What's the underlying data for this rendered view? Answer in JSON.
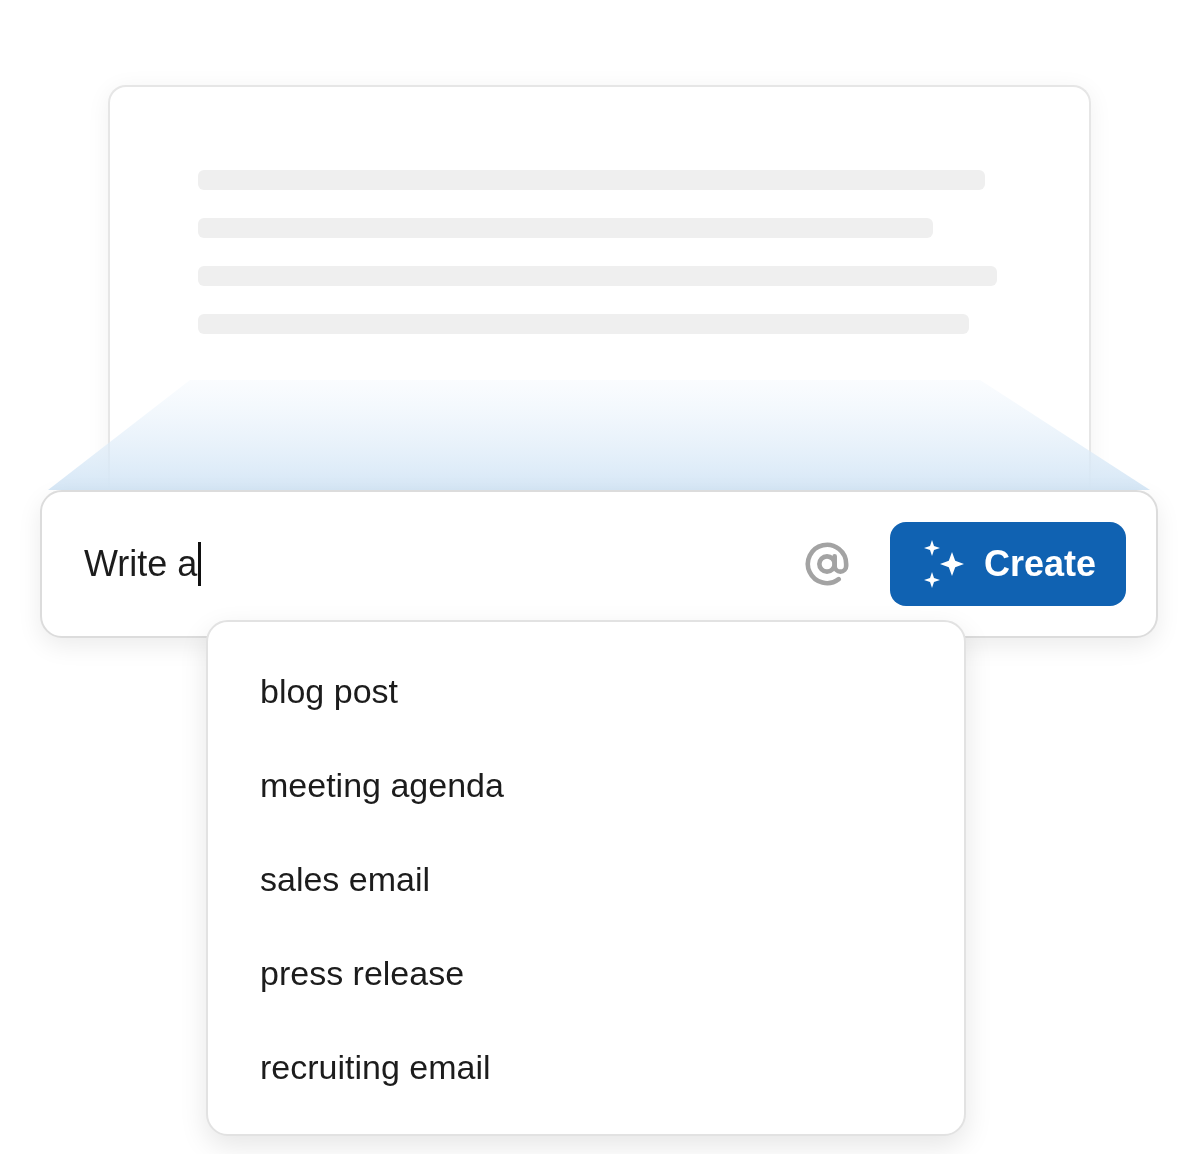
{
  "prompt": {
    "value": "Write a",
    "button": {
      "label": "Create"
    }
  },
  "suggestions": [
    {
      "label": "blog post"
    },
    {
      "label": "meeting agenda"
    },
    {
      "label": "sales email"
    },
    {
      "label": "press release"
    },
    {
      "label": "recruiting email"
    }
  ]
}
